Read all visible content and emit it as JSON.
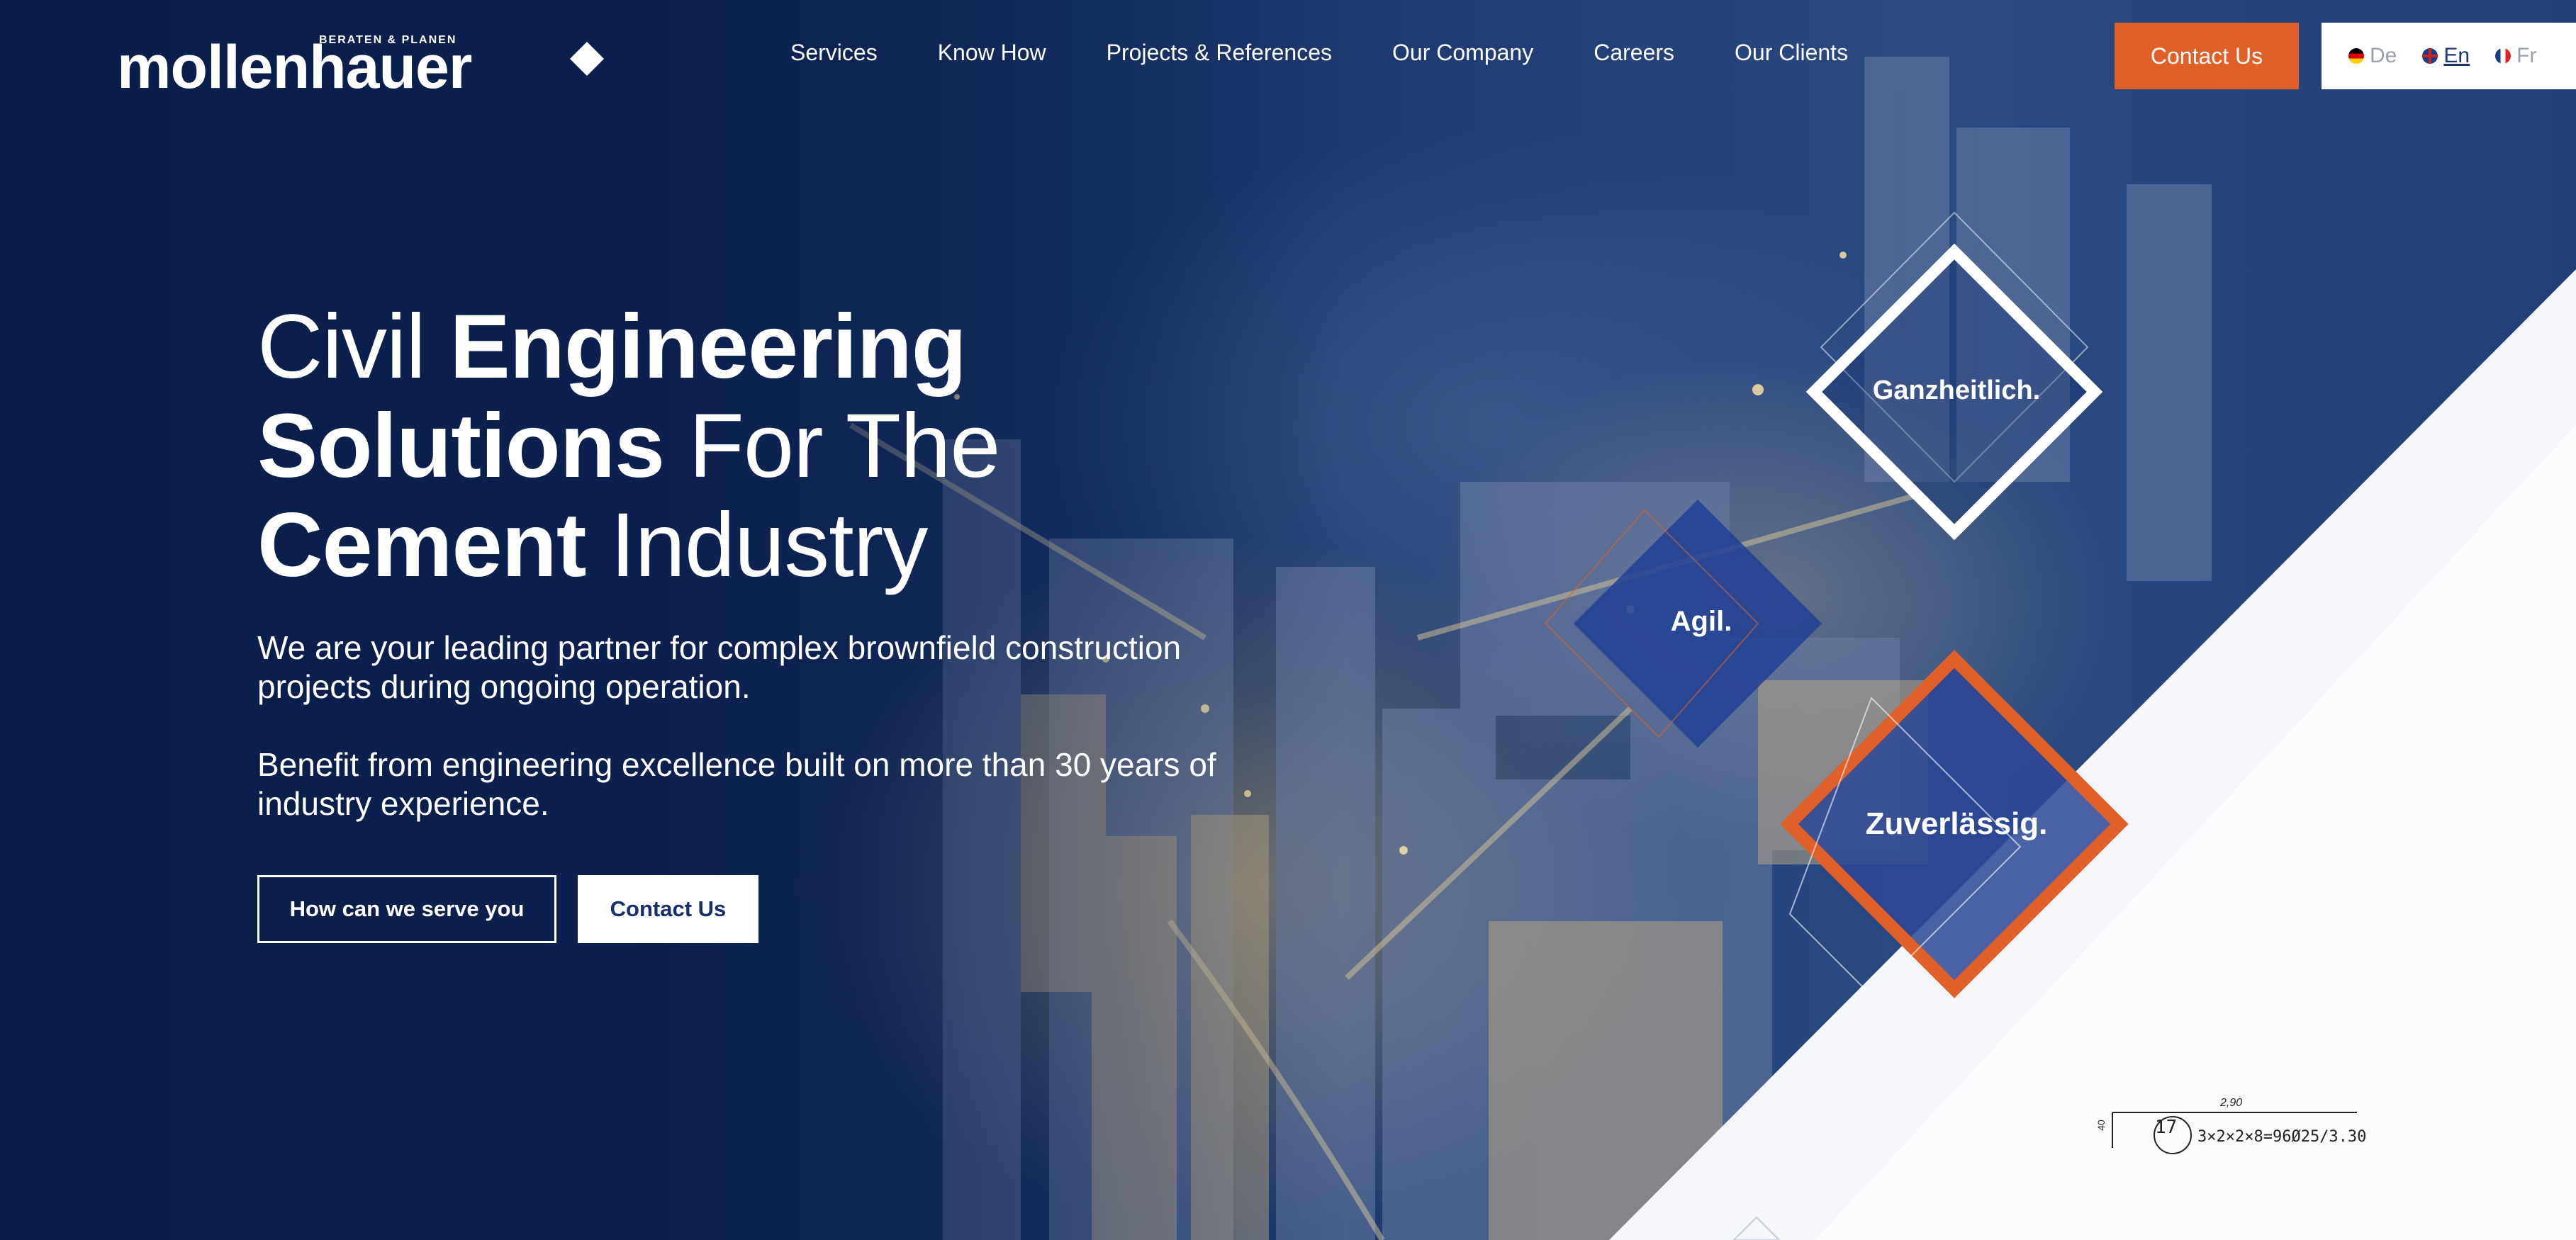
{
  "brand": {
    "name": "mollenhauer",
    "tagline": "BERATEN & PLANEN"
  },
  "nav": {
    "items": [
      "Services",
      "Know How",
      "Projects & References",
      "Our Company",
      "Careers",
      "Our Clients"
    ],
    "cta_label": "Contact Us"
  },
  "languages": {
    "items": [
      {
        "code": "De",
        "flag": "de-flag-icon",
        "active": false
      },
      {
        "code": "En",
        "flag": "uk-flag-icon",
        "active": true
      },
      {
        "code": "Fr",
        "flag": "fr-flag-icon",
        "active": false
      }
    ]
  },
  "hero": {
    "title_parts": [
      {
        "text": "Civil ",
        "bold": false
      },
      {
        "text": "Engineering",
        "bold": true
      },
      {
        "text": "Solutions",
        "bold": true
      },
      {
        "text": " For The",
        "bold": false
      },
      {
        "text": "Cement",
        "bold": true
      },
      {
        "text": " Industry",
        "bold": false
      }
    ],
    "paragraph_1": "We are your leading partner for complex brownfield construction projects during ongoing operation.",
    "paragraph_2": "Benefit from engineering excellence built on more than 30 years of industry experience.",
    "primary_button": "How can we serve you",
    "secondary_button": "Contact Us"
  },
  "values": {
    "items": [
      "Ganzheitlich.",
      "Agil.",
      "Zuverlässig."
    ]
  },
  "drawing": {
    "dimension_top": "2,90",
    "dimension_side": "40",
    "position_number": "17",
    "formula": "3×2×2×8=96Ø25/3.30"
  },
  "colors": {
    "navy": "#0d2352",
    "accent_orange": "#e0602a",
    "white": "#ffffff"
  }
}
